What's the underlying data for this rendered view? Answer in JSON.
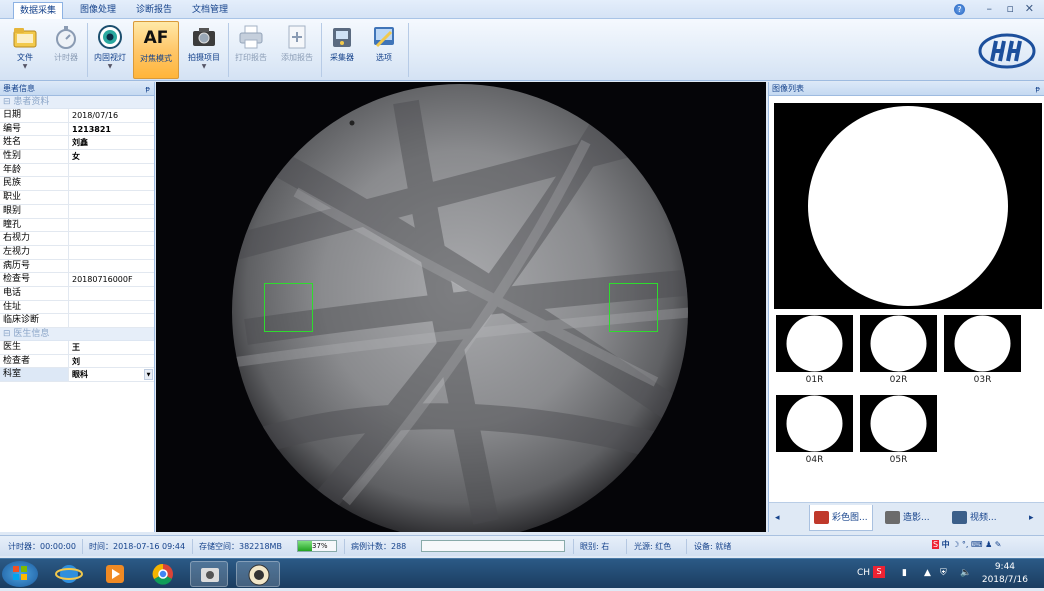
{
  "ribbon_tabs": [
    "数据采集",
    "图像处理",
    "诊断报告",
    "文档管理"
  ],
  "ribbon_buttons": {
    "file": "文件",
    "timer": "计时器",
    "fixation_light": "内固视灯",
    "focus_mode_icon": "AF",
    "focus_mode": "对焦模式",
    "capture_item": "拍摄项目",
    "print_report": "打印报告",
    "add_report": "添加报告",
    "collector": "采集器",
    "options": "选项"
  },
  "help_label": "?",
  "left_panel": {
    "title": "患者信息",
    "pin": "ᵽ",
    "patient_category": "患者资料",
    "patient_rows": [
      {
        "k": "日期",
        "v": "2018/07/16"
      },
      {
        "k": "编号",
        "v": "1213821"
      },
      {
        "k": "姓名",
        "v": "刘鑫"
      },
      {
        "k": "性别",
        "v": "女"
      },
      {
        "k": "年龄",
        "v": ""
      },
      {
        "k": "民族",
        "v": ""
      },
      {
        "k": "职业",
        "v": ""
      },
      {
        "k": "眼别",
        "v": ""
      },
      {
        "k": "瞳孔",
        "v": ""
      },
      {
        "k": "右视力",
        "v": ""
      },
      {
        "k": "左视力",
        "v": ""
      },
      {
        "k": "病历号",
        "v": ""
      },
      {
        "k": "检查号",
        "v": "20180716000F"
      },
      {
        "k": "电话",
        "v": ""
      },
      {
        "k": "住址",
        "v": ""
      },
      {
        "k": "临床诊断",
        "v": ""
      }
    ],
    "doctor_category": "医生信息",
    "doctor_rows": [
      {
        "k": "医生",
        "v": "王"
      },
      {
        "k": "检查者",
        "v": "刘"
      },
      {
        "k": "科室",
        "v": "眼科"
      }
    ]
  },
  "right_panel": {
    "title": "图像列表",
    "pin": "ᵽ",
    "thumbnails": [
      "01R",
      "02R",
      "03R",
      "04R",
      "05R"
    ],
    "bottom_tabs": [
      "彩色图...",
      "造影...",
      "视频..."
    ]
  },
  "status_bar": {
    "timer": "计时器：00:00:00",
    "time": "时间：2018-07-16 09:44",
    "storage": "存储空间：382218MB",
    "storage_percent": "37%",
    "storage_fraction": 0.37,
    "case_count": "病例计数：288",
    "eye": "眼别: 右",
    "light_source": "光源: 红色",
    "device": "设备: 就绪"
  },
  "taskbar": {
    "lang": "CH",
    "time": "9:44",
    "date": "2018/7/16"
  },
  "colors": {
    "ribbon_accent": "#ffc76a",
    "roi_box": "#2edc2e",
    "progress": "#22a322"
  }
}
